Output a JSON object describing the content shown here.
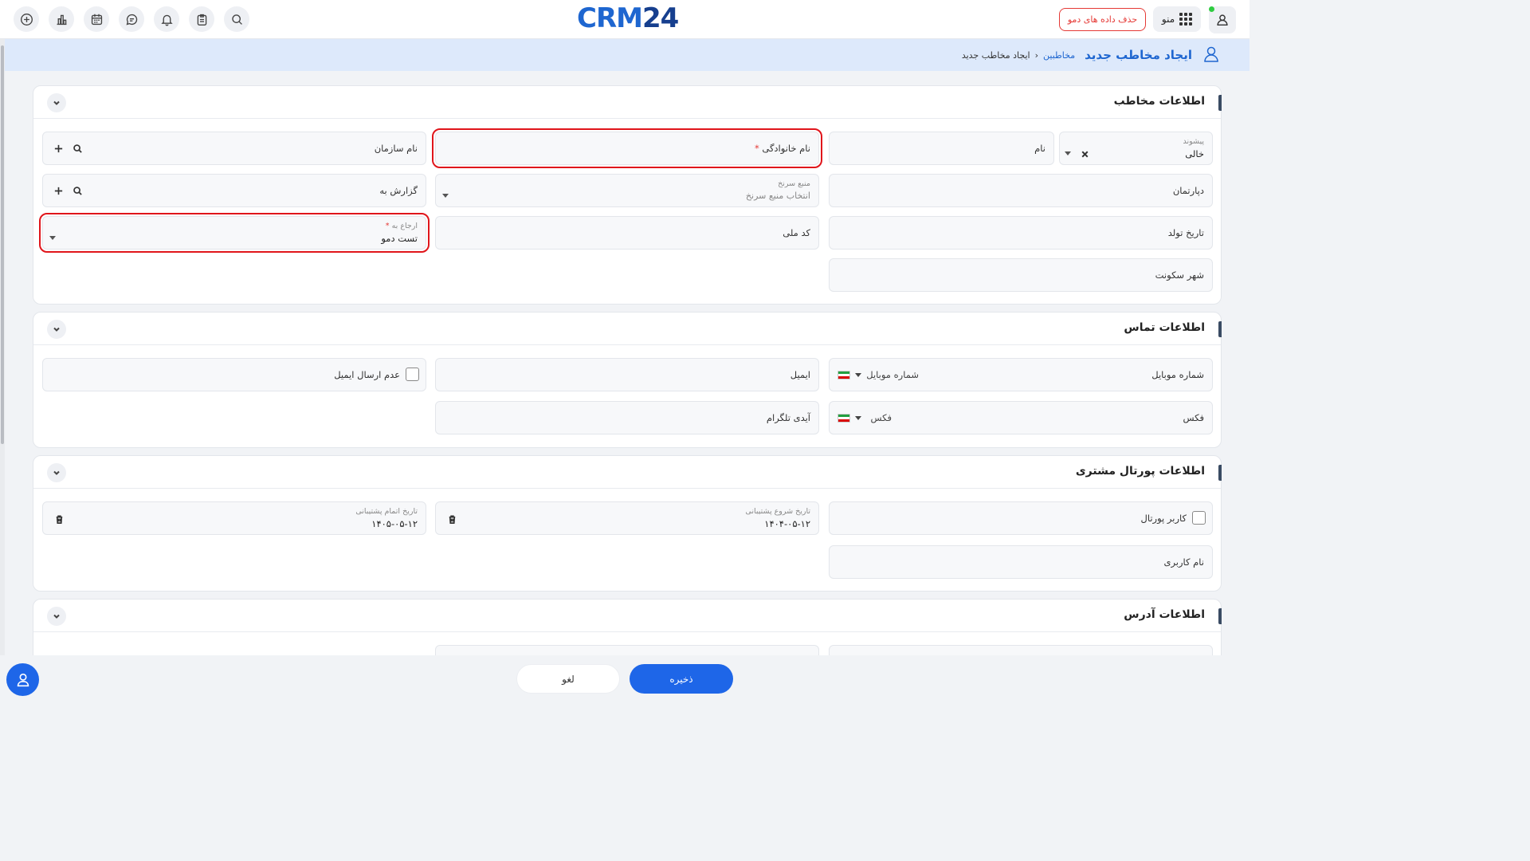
{
  "topbar": {
    "logo_a": "CRM",
    "logo_b": "24",
    "demo_button": "حذف داده های دمو",
    "menu_label": "منو",
    "icons": [
      "add-circle-icon",
      "bar-chart-icon",
      "calendar-icon",
      "chat-icon",
      "bell-icon",
      "clipboard-icon",
      "search-icon"
    ]
  },
  "header": {
    "title": "ایجاد مخاطب جدید",
    "breadcrumb_link": "مخاطبین",
    "breadcrumb_current": "ایجاد مخاطب جدید"
  },
  "contact_info": {
    "title": "اطلاعات مخاطب",
    "prefix_label": "پیشوند",
    "prefix_value": "خالی",
    "first_name": "نام",
    "last_name": "نام خانوادگی",
    "required_mark": "*",
    "organization": "نام سازمان",
    "department": "دپارتمان",
    "lead_source_label": "منبع سرنخ",
    "lead_source_placeholder": "انتخاب منبع سرنخ",
    "reports_to": "گزارش به",
    "birth_date": "تاریخ تولد",
    "national_code": "کد ملی",
    "assigned_to_label": "ارجاع به",
    "assigned_to_value": "تست دمو",
    "city": "شهر سکونت"
  },
  "contact_details": {
    "title": "اطلاعات تماس",
    "mobile_label": "شماره موبایل",
    "mobile_placeholder": "شماره موبایل",
    "email": "ایمیل",
    "no_email": "عدم ارسال ایمیل",
    "fax_label": "فکس",
    "fax_placeholder": "فکس",
    "telegram": "آیدی تلگرام"
  },
  "portal_info": {
    "title": "اطلاعات پورتال مشتری",
    "portal_user": "کاربر پورتال",
    "support_start_label": "تاریخ شروع پشتیبانی",
    "support_start_value": "۱۴۰۴-۰۵-۱۲",
    "support_end_label": "تاریخ اتمام پشتیبانی",
    "support_end_value": "۱۴۰۵-۰۵-۱۲",
    "username": "نام کاربری"
  },
  "address_info": {
    "title": "اطلاعات آدرس"
  },
  "footer": {
    "save": "ذخیره",
    "cancel": "لغو"
  },
  "colors": {
    "primary": "#1e66e8",
    "highlight_border": "#e0151b",
    "header_strip": "#dde9fb"
  }
}
